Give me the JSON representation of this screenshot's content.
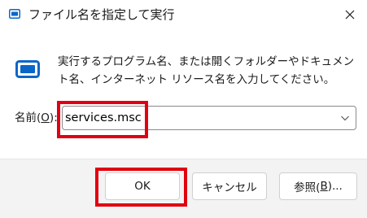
{
  "window": {
    "title": "ファイル名を指定して実行",
    "app_icon": "run-dialog-icon",
    "close_icon": "close-icon"
  },
  "content": {
    "icon": "run-dialog-icon",
    "description": "実行するプログラム名、または開くフォルダーやドキュメント名、インターネット リソース名を入力してください。"
  },
  "name_field": {
    "label_prefix": "名前(",
    "label_key": "O",
    "label_suffix": "):",
    "value": "services.msc",
    "dropdown_icon": "chevron-down-icon"
  },
  "buttons": {
    "ok": "OK",
    "cancel": "キャンセル",
    "browse_prefix": "参照(",
    "browse_key": "B",
    "browse_suffix": ")..."
  },
  "colors": {
    "highlight": "#e1000f",
    "accent": "#0067c0",
    "footer": "#f3f3f3"
  }
}
